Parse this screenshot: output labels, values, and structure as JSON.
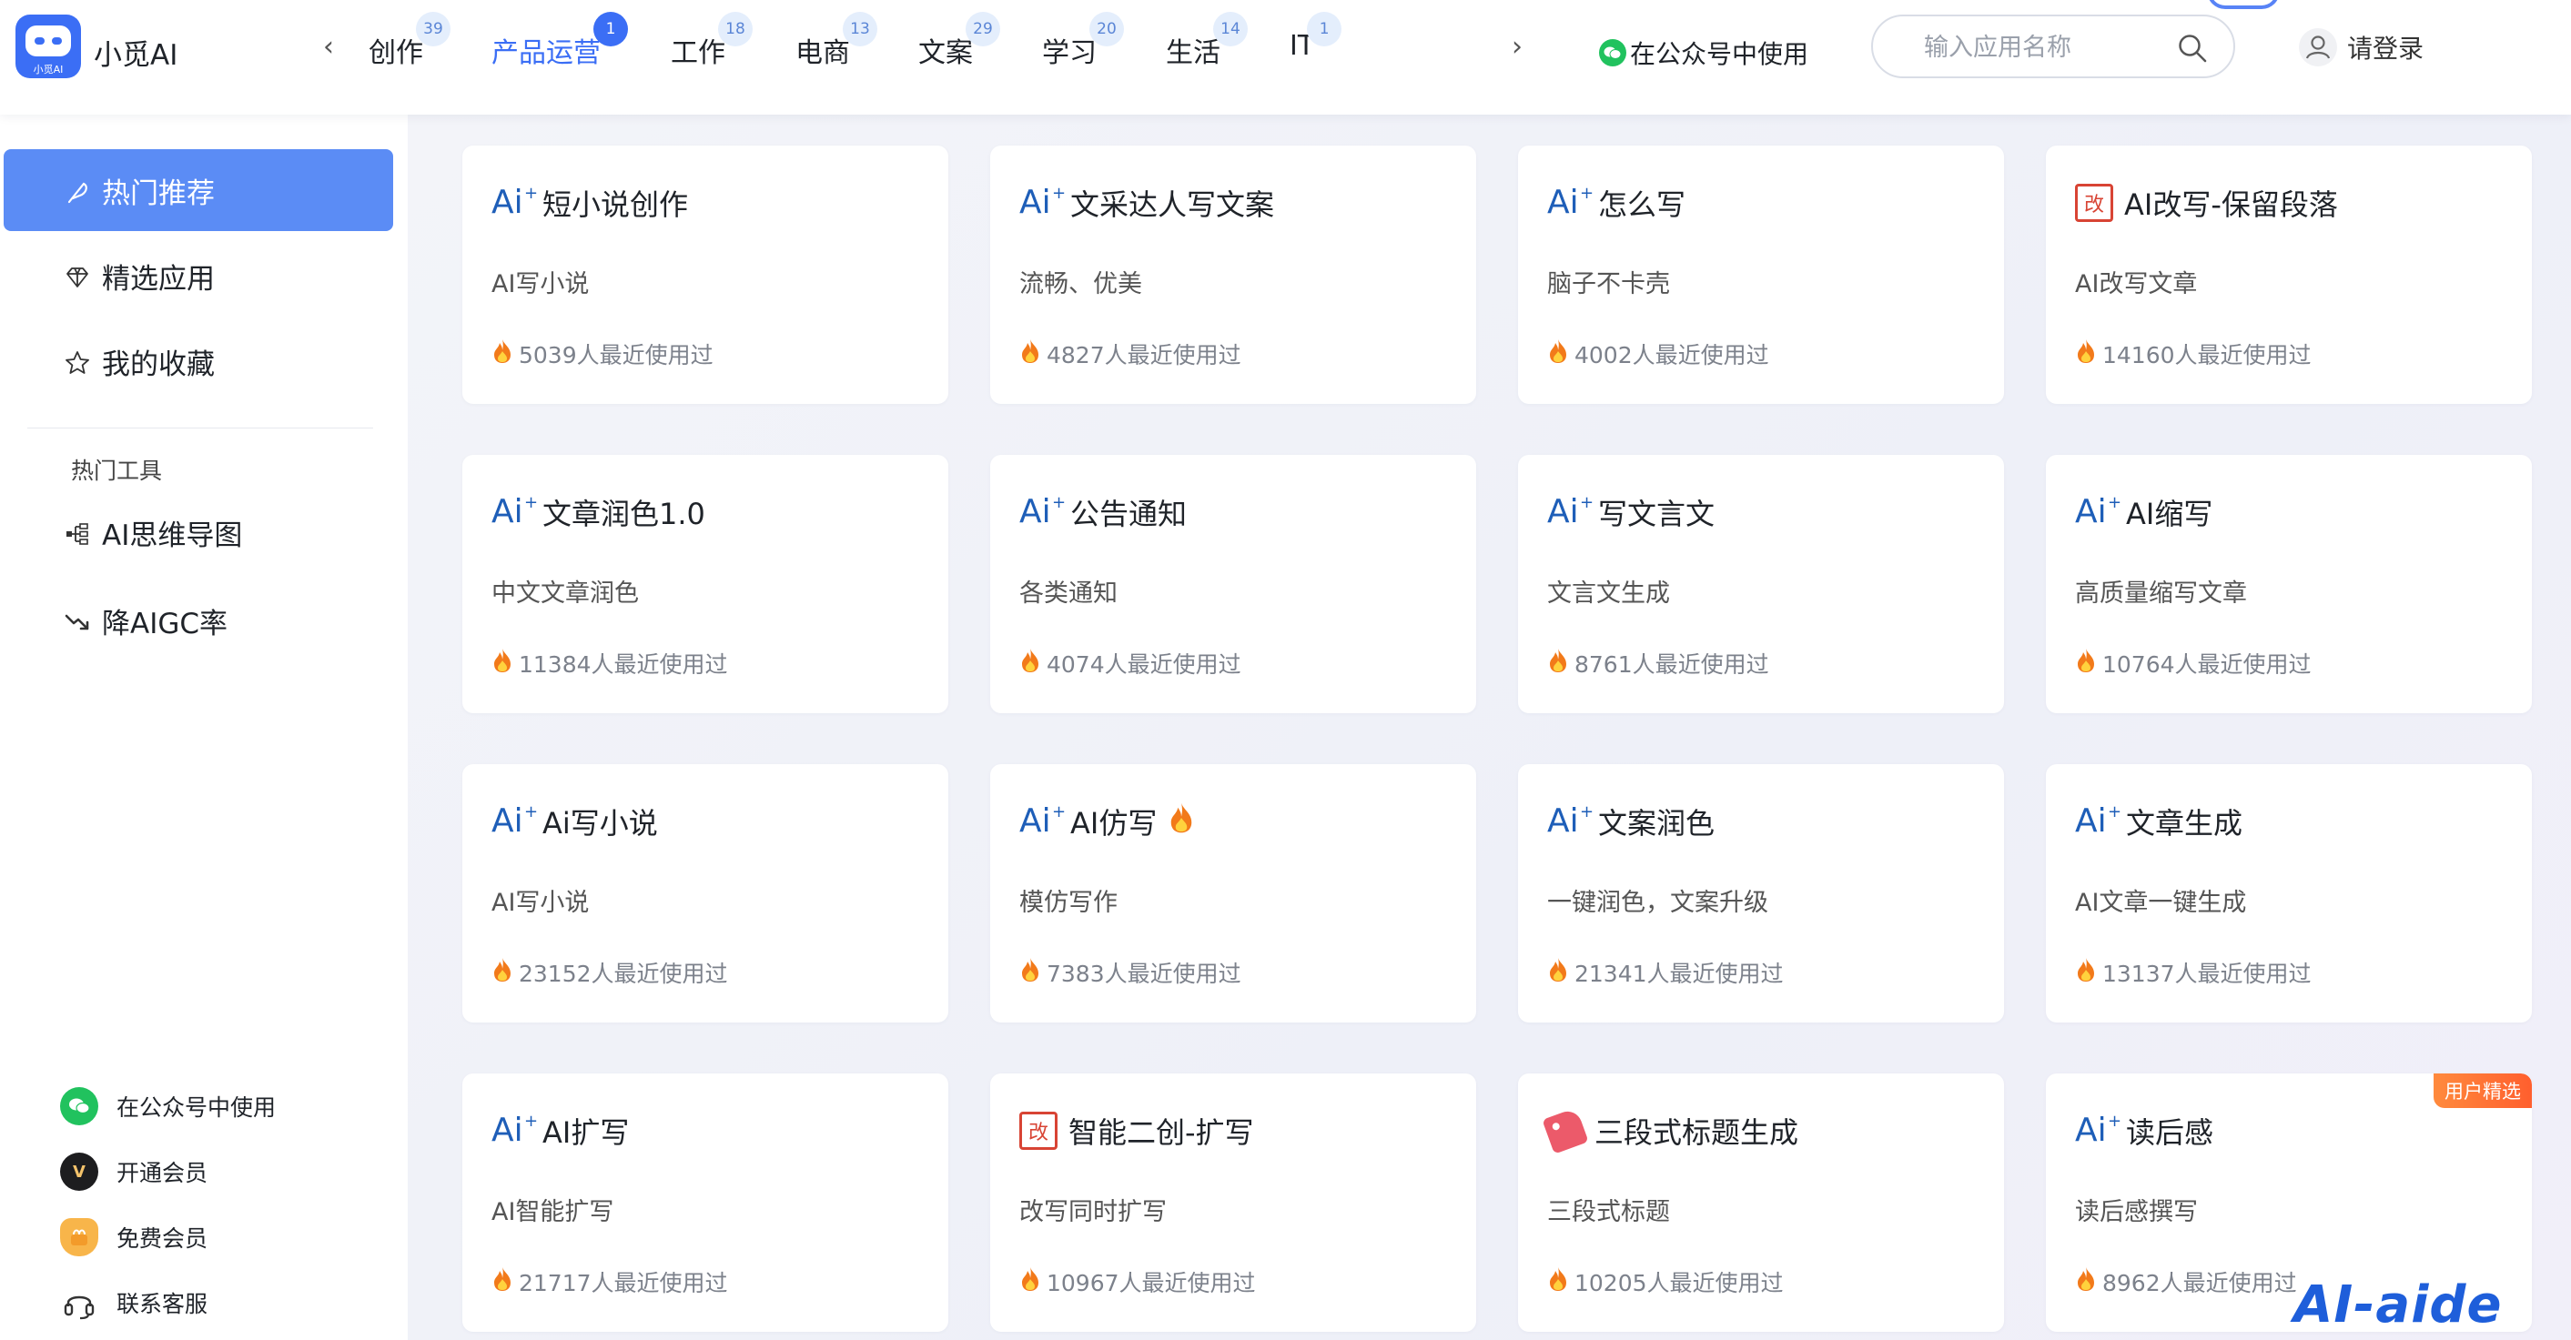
{
  "header": {
    "logo_sub": "小觅AI",
    "brand": "小觅AI",
    "tabs": [
      {
        "label": "创作",
        "badge": "39"
      },
      {
        "label": "产品运营",
        "badge": "1"
      },
      {
        "label": "工作",
        "badge": "18"
      },
      {
        "label": "电商",
        "badge": "13"
      },
      {
        "label": "文案",
        "badge": "29"
      },
      {
        "label": "学习",
        "badge": "20"
      },
      {
        "label": "生活",
        "badge": "14"
      },
      {
        "label": "IT",
        "badge": "1"
      }
    ],
    "active_tab": "产品运营",
    "prev_arrow": "‹",
    "next_arrow": "›",
    "wechat_label": "在公众号中使用",
    "search_placeholder": "输入应用名称",
    "login_label": "请登录"
  },
  "sidebar": {
    "items": [
      {
        "label": "热门推荐",
        "icon": "feather-icon"
      },
      {
        "label": "精选应用",
        "icon": "diamond-icon"
      },
      {
        "label": "我的收藏",
        "icon": "star-icon"
      }
    ],
    "section_title": "热门工具",
    "tools": [
      {
        "label": "AI思维导图",
        "icon": "mindmap-icon"
      },
      {
        "label": "降AIGC率",
        "icon": "trend-down-icon"
      }
    ],
    "bottom": [
      {
        "label": "在公众号中使用",
        "icon": "wechat-icon"
      },
      {
        "label": "开通会员",
        "icon": "vip-icon"
      },
      {
        "label": "免费会员",
        "icon": "gift-icon"
      },
      {
        "label": "联系客服",
        "icon": "headset-icon"
      }
    ]
  },
  "cards": [
    {
      "icon": "ai",
      "title": "短小说创作",
      "desc": "AI写小说",
      "usage": "5039人最近使用过"
    },
    {
      "icon": "ai",
      "title": "文采达人写文案",
      "desc": "流畅、优美",
      "usage": "4827人最近使用过"
    },
    {
      "icon": "ai",
      "title": "怎么写",
      "desc": "脑子不卡壳",
      "usage": "4002人最近使用过"
    },
    {
      "icon": "gai",
      "title": "AI改写-保留段落",
      "desc": "AI改写文章",
      "usage": "14160人最近使用过"
    },
    {
      "icon": "ai",
      "title": "文章润色1.0",
      "desc": "中文文章润色",
      "usage": "11384人最近使用过"
    },
    {
      "icon": "ai",
      "title": "公告通知",
      "desc": "各类通知",
      "usage": "4074人最近使用过"
    },
    {
      "icon": "ai",
      "title": "写文言文",
      "desc": "文言文生成",
      "usage": "8761人最近使用过"
    },
    {
      "icon": "ai",
      "title": "AI缩写",
      "desc": "高质量缩写文章",
      "usage": "10764人最近使用过"
    },
    {
      "icon": "ai",
      "title": "Ai写小说",
      "desc": "AI写小说",
      "usage": "23152人最近使用过"
    },
    {
      "icon": "ai",
      "title": "AI仿写",
      "title_flame": true,
      "desc": "模仿写作",
      "usage": "7383人最近使用过"
    },
    {
      "icon": "ai",
      "title": "文案润色",
      "desc": "一键润色，文案升级",
      "usage": "21341人最近使用过"
    },
    {
      "icon": "ai",
      "title": "文章生成",
      "desc": "AI文章一键生成",
      "usage": "13137人最近使用过"
    },
    {
      "icon": "ai",
      "title": "AI扩写",
      "desc": "AI智能扩写",
      "usage": "21717人最近使用过"
    },
    {
      "icon": "gai",
      "title": "智能二创-扩写",
      "desc": "改写同时扩写",
      "usage": "10967人最近使用过"
    },
    {
      "icon": "tag",
      "title": "三段式标题生成",
      "desc": "三段式标题",
      "usage": "10205人最近使用过"
    },
    {
      "icon": "ai",
      "title": "读后感",
      "desc": "读后感撰写",
      "usage": "8962人最近使用过",
      "badge": "用户精选"
    }
  ],
  "icon_glyphs": {
    "ai": "Ai",
    "spark": "+",
    "gai": "改"
  },
  "watermark": "AI-aide",
  "colors": {
    "accent": "#3b6ef5",
    "sidebar_active": "#5b8cf5",
    "ai_icon": "#1e5eb8",
    "flame": "#f27a1a",
    "badge": "#ff6a33"
  }
}
